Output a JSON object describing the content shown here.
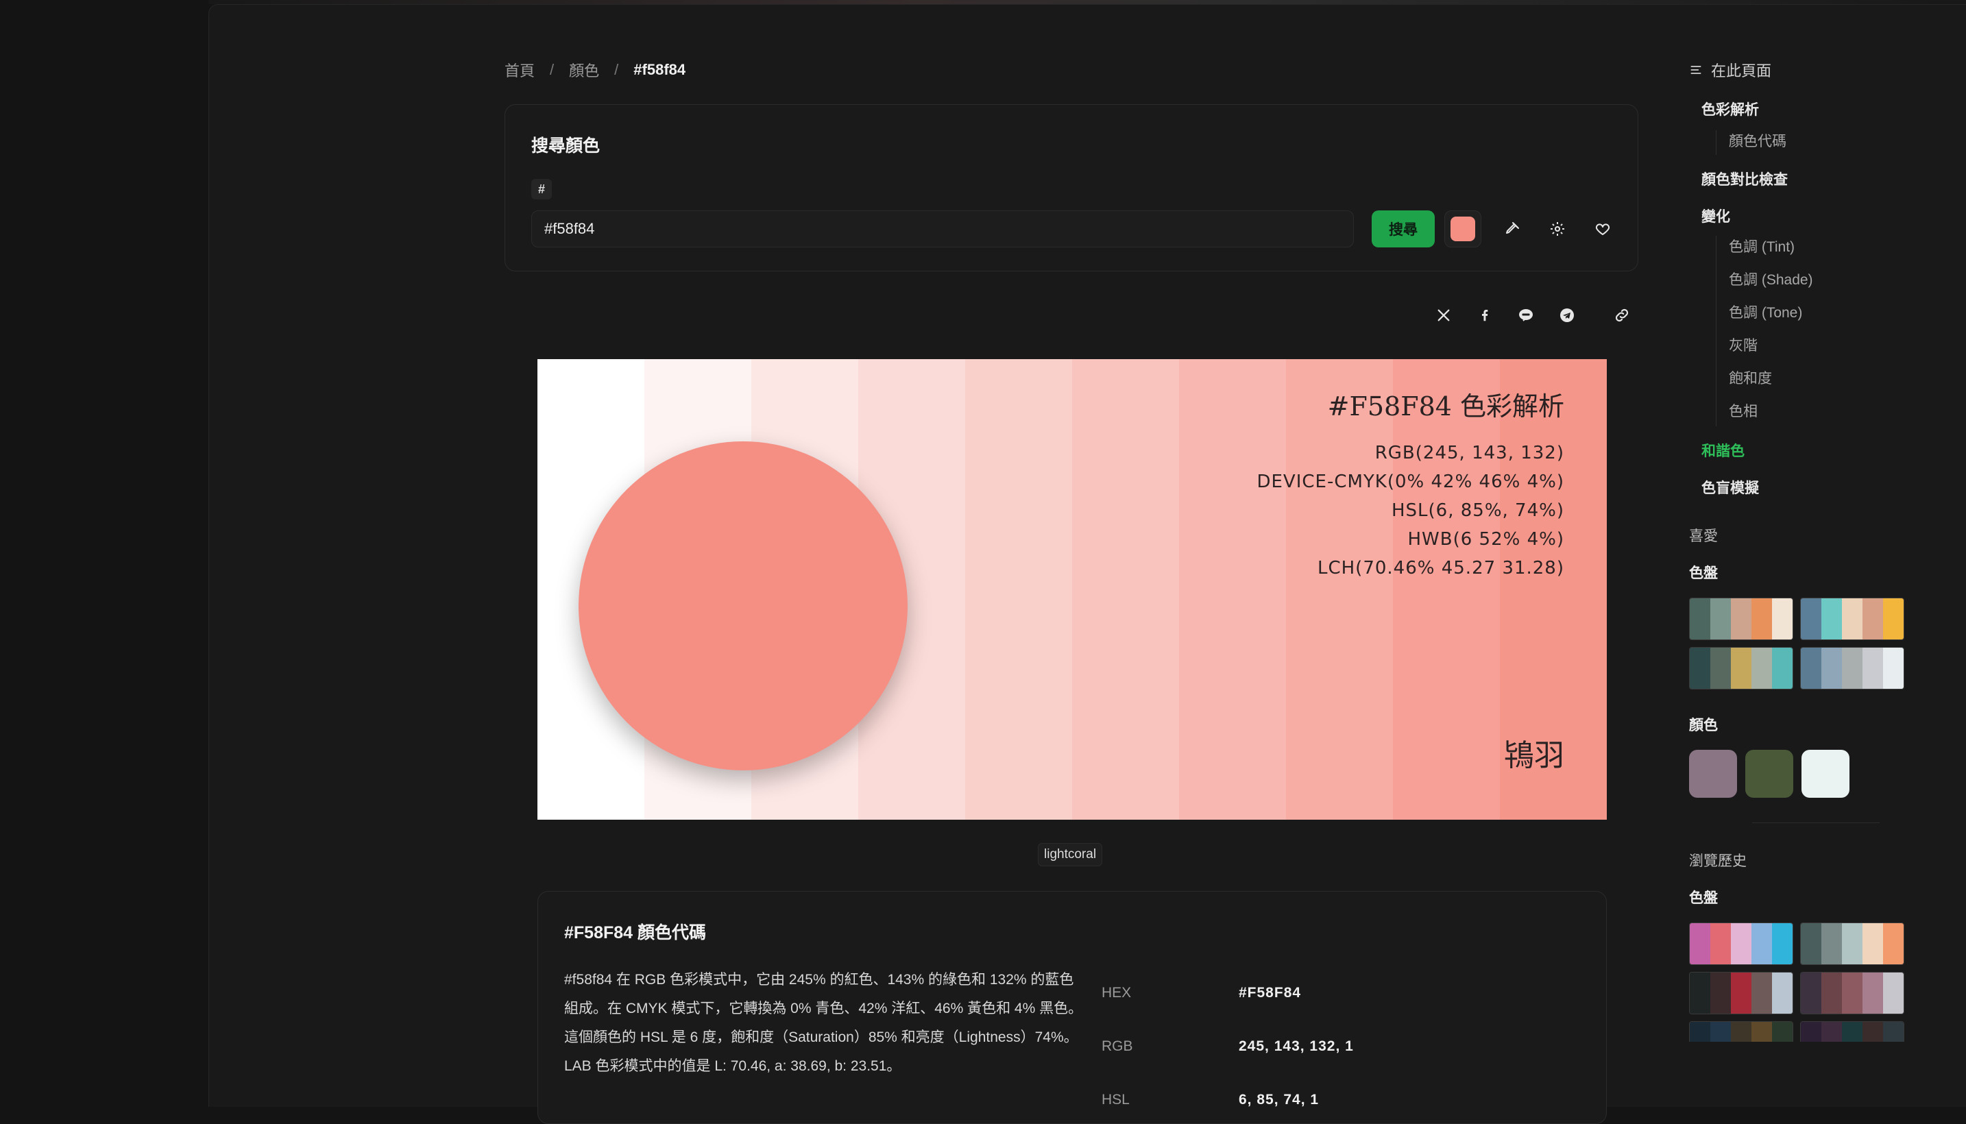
{
  "breadcrumb": {
    "home": "首頁",
    "colors": "顏色",
    "current": "#f58f84",
    "sep": "/"
  },
  "search": {
    "title": "搜尋顏色",
    "prefix": "#",
    "value": "#f58f84",
    "button": "搜尋",
    "swatch_color": "#f58f84",
    "icons": [
      "eyedropper-icon",
      "gear-icon",
      "heart-icon"
    ]
  },
  "share": {
    "icons": [
      "x-icon",
      "facebook-icon",
      "line-icon",
      "telegram-icon",
      "link-icon"
    ]
  },
  "hero": {
    "title": "#F58F84 色彩解析",
    "rgb": "RGB(245, 143, 132)",
    "cmyk": "DEVICE-CMYK(0% 42% 46% 4%)",
    "hsl": "HSL(6, 85%, 74%)",
    "hwb": "HWB(6 52% 4%)",
    "lch": "LCH(70.46% 45.27 31.28)",
    "name": "鴇羽",
    "main_color": "#f58f84",
    "bands": [
      "#ffffff",
      "#fdf3f2",
      "#fce7e5",
      "#fbdbd8",
      "#fad0cb",
      "#f9c4be",
      "#f8b8b1",
      "#f7aca4",
      "#f6a097",
      "#f5968b"
    ]
  },
  "name_badge": "lightcoral",
  "code": {
    "title": "#F58F84 顏色代碼",
    "description": "#f58f84 在 RGB 色彩模式中，它由 245% 的紅色、143% 的綠色和 132% 的藍色組成。在 CMYK 模式下，它轉換為 0% 青色、42% 洋紅、46% 黃色和 4% 黑色。這個顏色的 HSL 是 6 度，飽和度（Saturation）85% 和亮度（Lightness）74%。LAB 色彩模式中的值是 L: 70.46, a: 38.69, b: 23.51。",
    "rows": [
      {
        "key": "HEX",
        "value": "#F58F84"
      },
      {
        "key": "RGB",
        "value": "245, 143, 132, 1"
      },
      {
        "key": "HSL",
        "value": "6, 85, 74, 1"
      }
    ]
  },
  "toc": {
    "heading": "在此頁面",
    "items": [
      {
        "label": "色彩解析",
        "level": 1
      },
      {
        "label": "顏色代碼",
        "level": 2
      },
      {
        "label": "顏色對比檢查",
        "level": 1
      },
      {
        "label": "變化",
        "level": 1
      },
      {
        "label": "色調 (Tint)",
        "level": 2
      },
      {
        "label": "色調 (Shade)",
        "level": 2
      },
      {
        "label": "色調 (Tone)",
        "level": 2
      },
      {
        "label": "灰階",
        "level": 2
      },
      {
        "label": "飽和度",
        "level": 2
      },
      {
        "label": "色相",
        "level": 2
      },
      {
        "label": "和諧色",
        "level": 1,
        "active": true
      },
      {
        "label": "色盲模擬",
        "level": 1
      }
    ]
  },
  "favorites": {
    "label": "喜愛",
    "palettes_label": "色盤",
    "palettes": [
      [
        "#4c6660",
        "#7c958d",
        "#cfa48e",
        "#e8915a",
        "#f1e4d4"
      ],
      [
        "#5b7f99",
        "#6cc9c4",
        "#ecd2b8",
        "#d8a086",
        "#f2b63c"
      ],
      [
        "#2f4a4b",
        "#586a5f",
        "#c5a85b",
        "#a7b1a6",
        "#58b9b6"
      ],
      [
        "#5b7c93",
        "#8ea6b8",
        "#a9aeae",
        "#c9cbd1",
        "#e8eef0"
      ]
    ],
    "colors_label": "顏色",
    "colors": [
      "#8a7585",
      "#4a5a38",
      "#eaf3f2"
    ]
  },
  "history": {
    "label": "瀏覽歷史",
    "palettes_label": "色盤",
    "palettes": [
      [
        "#c462a8",
        "#e26a72",
        "#e4b4d4",
        "#8ab4e0",
        "#30b4dc"
      ],
      [
        "#4a5e5e",
        "#7a8a88",
        "#b0c4c4",
        "#f0d4bc",
        "#f29a6c"
      ],
      [
        "#1e2524",
        "#3a2a2c",
        "#a62a38",
        "#6f5a5a",
        "#b9c6d2"
      ],
      [
        "#3c3240",
        "#6a4448",
        "#8c5a60",
        "#a77e8e",
        "#c6c6cc"
      ],
      [
        "#1a2a36",
        "#22384a",
        "#3e3628",
        "#5e4a2a",
        "#2a3a2c"
      ],
      [
        "#2c2034",
        "#3e2c3e",
        "#1c3a3c",
        "#3a2c2a",
        "#2e3a40"
      ]
    ]
  }
}
